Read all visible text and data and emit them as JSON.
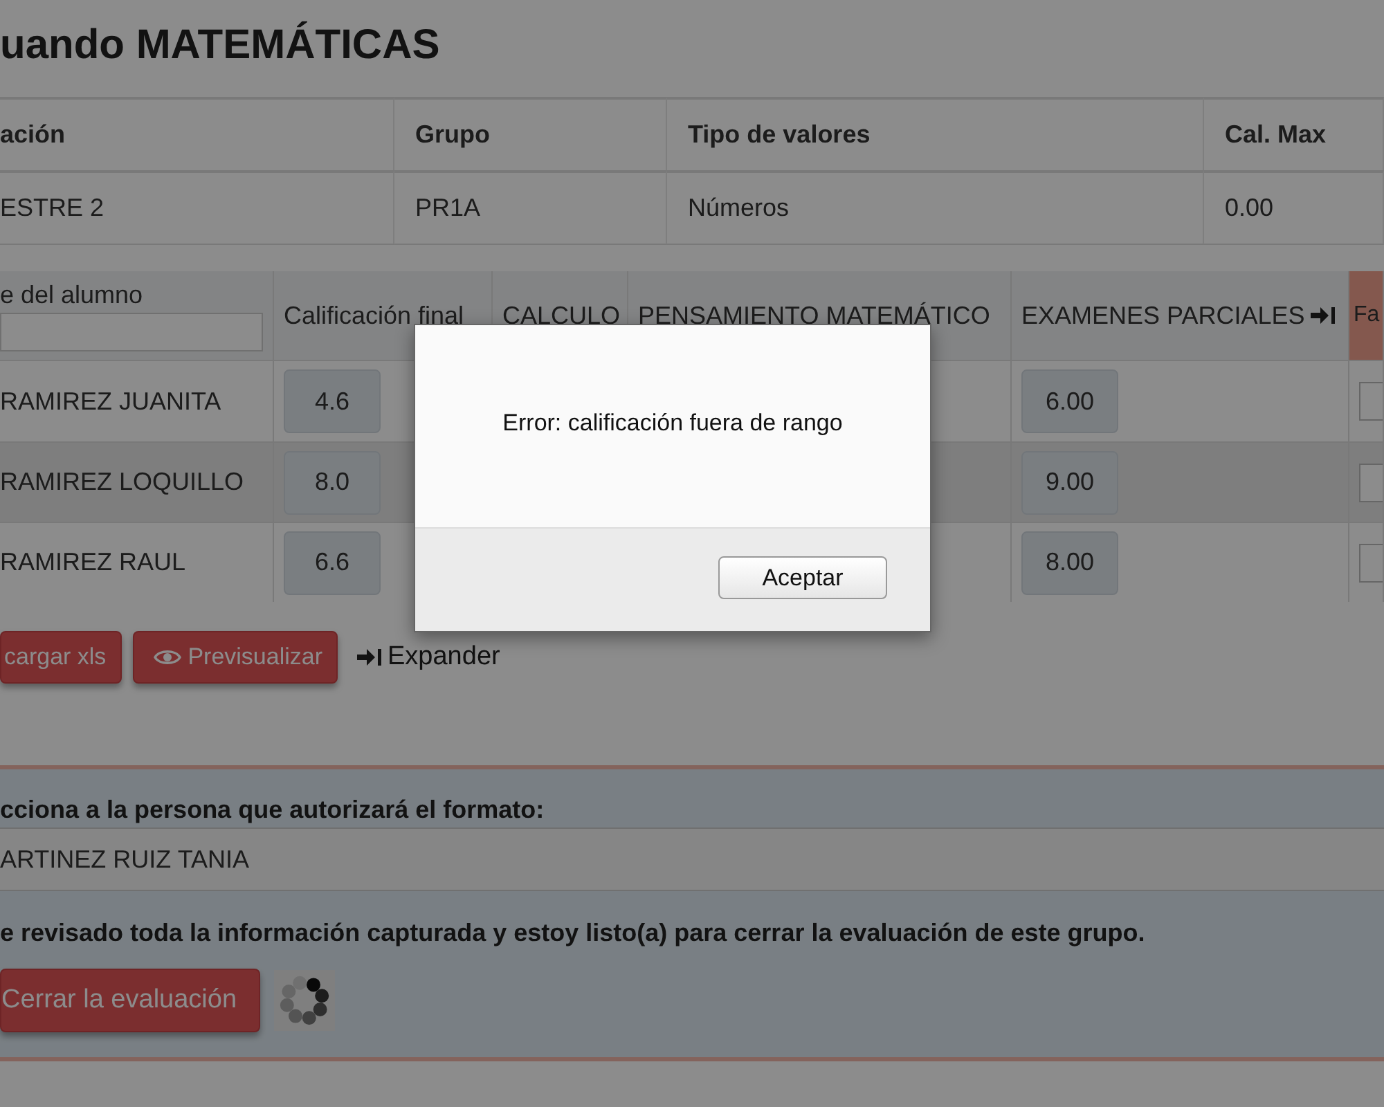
{
  "title": "uando MATEMÁTICAS",
  "info_table": {
    "columns": [
      "ación",
      "Grupo",
      "Tipo de valores",
      "Cal. Max"
    ],
    "row": [
      "ESTRE 2",
      "PR1A",
      "Números",
      "0.00"
    ]
  },
  "grades_table": {
    "columns": [
      {
        "label": "e del alumno",
        "highlighted": false,
        "expandable": false
      },
      {
        "label": "Calificación final",
        "highlighted": false,
        "expandable": false
      },
      {
        "label": "CALCULO",
        "highlighted": false,
        "expandable": false
      },
      {
        "label": "PENSAMIENTO MATEMÁTICO",
        "highlighted": false,
        "expandable": false
      },
      {
        "label": "EXAMENES PARCIALES",
        "highlighted": false,
        "expandable": true
      },
      {
        "label": "Fa",
        "highlighted": true,
        "expandable": false
      }
    ],
    "rows": [
      {
        "name": "RAMIREZ JUANITA",
        "final": "4.6",
        "examenes": "6.00"
      },
      {
        "name": "RAMIREZ LOQUILLO",
        "final": "8.0",
        "examenes": "9.00"
      },
      {
        "name": "RAMIREZ RAUL",
        "final": "6.6",
        "examenes": "8.00"
      }
    ]
  },
  "actions": [
    {
      "kind": "plain",
      "label": "cargar xls"
    },
    {
      "kind": "preview",
      "label": "Previsualizar"
    },
    {
      "kind": "expand",
      "label": "Expander"
    }
  ],
  "authorizer": {
    "label": "cciona a la persona que autorizará el formato:",
    "value": "ARTINEZ RUIZ TANIA"
  },
  "confirm_text": "e revisado toda la información capturada y estoy listo(a) para cerrar la evaluación de este grupo.",
  "close_button": "Cerrar la evaluación",
  "dialog": {
    "message": "Error: calificación fuera de rango",
    "button": "Aceptar"
  }
}
